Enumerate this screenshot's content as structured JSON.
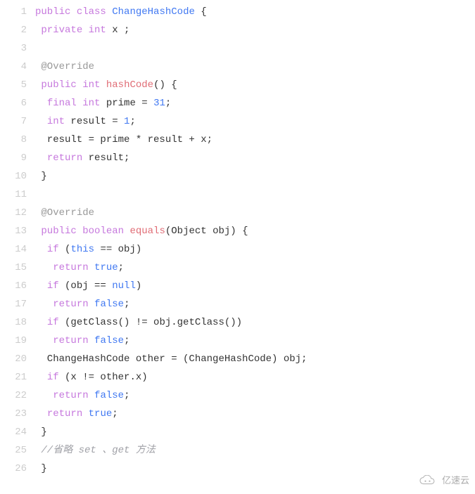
{
  "watermark": "亿速云",
  "lines": [
    {
      "n": "1",
      "seg": [
        {
          "c": "kw",
          "t": "public"
        },
        {
          "c": "",
          "t": " "
        },
        {
          "c": "kw",
          "t": "class"
        },
        {
          "c": "",
          "t": " "
        },
        {
          "c": "cls",
          "t": "ChangeHashCode"
        },
        {
          "c": "",
          "t": " {"
        }
      ]
    },
    {
      "n": "2",
      "seg": [
        {
          "c": "",
          "t": " "
        },
        {
          "c": "kw",
          "t": "private"
        },
        {
          "c": "",
          "t": " "
        },
        {
          "c": "type",
          "t": "int"
        },
        {
          "c": "",
          "t": " x ;"
        }
      ]
    },
    {
      "n": "3",
      "seg": [
        {
          "c": "",
          "t": ""
        }
      ]
    },
    {
      "n": "4",
      "seg": [
        {
          "c": "",
          "t": " "
        },
        {
          "c": "ann",
          "t": "@Override"
        }
      ]
    },
    {
      "n": "5",
      "seg": [
        {
          "c": "",
          "t": " "
        },
        {
          "c": "kw",
          "t": "public"
        },
        {
          "c": "",
          "t": " "
        },
        {
          "c": "type",
          "t": "int"
        },
        {
          "c": "",
          "t": " "
        },
        {
          "c": "fn",
          "t": "hashCode"
        },
        {
          "c": "",
          "t": "() {"
        }
      ]
    },
    {
      "n": "6",
      "seg": [
        {
          "c": "",
          "t": "  "
        },
        {
          "c": "kw",
          "t": "final"
        },
        {
          "c": "",
          "t": " "
        },
        {
          "c": "type",
          "t": "int"
        },
        {
          "c": "",
          "t": " prime = "
        },
        {
          "c": "num",
          "t": "31"
        },
        {
          "c": "",
          "t": ";"
        }
      ]
    },
    {
      "n": "7",
      "seg": [
        {
          "c": "",
          "t": "  "
        },
        {
          "c": "type",
          "t": "int"
        },
        {
          "c": "",
          "t": " result = "
        },
        {
          "c": "num",
          "t": "1"
        },
        {
          "c": "",
          "t": ";"
        }
      ]
    },
    {
      "n": "8",
      "seg": [
        {
          "c": "",
          "t": "  result = prime * result + x;"
        }
      ]
    },
    {
      "n": "9",
      "seg": [
        {
          "c": "",
          "t": "  "
        },
        {
          "c": "kw",
          "t": "return"
        },
        {
          "c": "",
          "t": " result;"
        }
      ]
    },
    {
      "n": "10",
      "seg": [
        {
          "c": "",
          "t": " }"
        }
      ]
    },
    {
      "n": "11",
      "seg": [
        {
          "c": "",
          "t": ""
        }
      ]
    },
    {
      "n": "12",
      "seg": [
        {
          "c": "",
          "t": " "
        },
        {
          "c": "ann",
          "t": "@Override"
        }
      ]
    },
    {
      "n": "13",
      "seg": [
        {
          "c": "",
          "t": " "
        },
        {
          "c": "kw",
          "t": "public"
        },
        {
          "c": "",
          "t": " "
        },
        {
          "c": "type",
          "t": "boolean"
        },
        {
          "c": "",
          "t": " "
        },
        {
          "c": "fn",
          "t": "equals"
        },
        {
          "c": "",
          "t": "(Object obj) {"
        }
      ]
    },
    {
      "n": "14",
      "seg": [
        {
          "c": "",
          "t": "  "
        },
        {
          "c": "kw",
          "t": "if"
        },
        {
          "c": "",
          "t": " ("
        },
        {
          "c": "lit",
          "t": "this"
        },
        {
          "c": "",
          "t": " == obj)"
        }
      ]
    },
    {
      "n": "15",
      "seg": [
        {
          "c": "",
          "t": "   "
        },
        {
          "c": "kw",
          "t": "return"
        },
        {
          "c": "",
          "t": " "
        },
        {
          "c": "lit",
          "t": "true"
        },
        {
          "c": "",
          "t": ";"
        }
      ]
    },
    {
      "n": "16",
      "seg": [
        {
          "c": "",
          "t": "  "
        },
        {
          "c": "kw",
          "t": "if"
        },
        {
          "c": "",
          "t": " (obj == "
        },
        {
          "c": "lit",
          "t": "null"
        },
        {
          "c": "",
          "t": ")"
        }
      ]
    },
    {
      "n": "17",
      "seg": [
        {
          "c": "",
          "t": "   "
        },
        {
          "c": "kw",
          "t": "return"
        },
        {
          "c": "",
          "t": " "
        },
        {
          "c": "lit",
          "t": "false"
        },
        {
          "c": "",
          "t": ";"
        }
      ]
    },
    {
      "n": "18",
      "seg": [
        {
          "c": "",
          "t": "  "
        },
        {
          "c": "kw",
          "t": "if"
        },
        {
          "c": "",
          "t": " (getClass() != obj.getClass())"
        }
      ]
    },
    {
      "n": "19",
      "seg": [
        {
          "c": "",
          "t": "   "
        },
        {
          "c": "kw",
          "t": "return"
        },
        {
          "c": "",
          "t": " "
        },
        {
          "c": "lit",
          "t": "false"
        },
        {
          "c": "",
          "t": ";"
        }
      ]
    },
    {
      "n": "20",
      "seg": [
        {
          "c": "",
          "t": "  ChangeHashCode other = (ChangeHashCode) obj;"
        }
      ]
    },
    {
      "n": "21",
      "seg": [
        {
          "c": "",
          "t": "  "
        },
        {
          "c": "kw",
          "t": "if"
        },
        {
          "c": "",
          "t": " (x != other.x)"
        }
      ]
    },
    {
      "n": "22",
      "seg": [
        {
          "c": "",
          "t": "   "
        },
        {
          "c": "kw",
          "t": "return"
        },
        {
          "c": "",
          "t": " "
        },
        {
          "c": "lit",
          "t": "false"
        },
        {
          "c": "",
          "t": ";"
        }
      ]
    },
    {
      "n": "23",
      "seg": [
        {
          "c": "",
          "t": "  "
        },
        {
          "c": "kw",
          "t": "return"
        },
        {
          "c": "",
          "t": " "
        },
        {
          "c": "lit",
          "t": "true"
        },
        {
          "c": "",
          "t": ";"
        }
      ]
    },
    {
      "n": "24",
      "seg": [
        {
          "c": "",
          "t": " }"
        }
      ]
    },
    {
      "n": "25",
      "seg": [
        {
          "c": "",
          "t": " "
        },
        {
          "c": "com",
          "t": "//省略 set 、get 方法"
        }
      ]
    },
    {
      "n": "26",
      "seg": [
        {
          "c": "",
          "t": " }"
        }
      ]
    }
  ]
}
